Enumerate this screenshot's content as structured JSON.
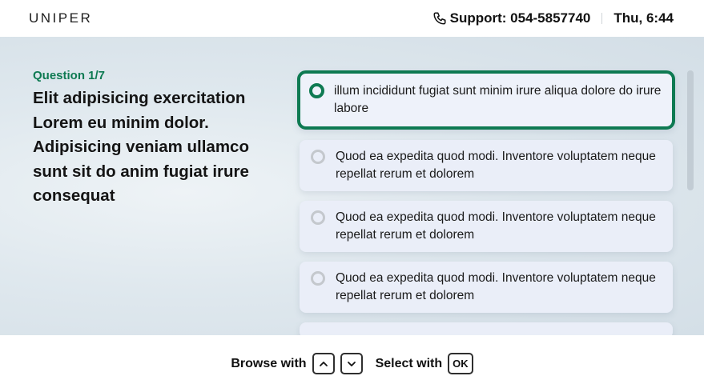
{
  "header": {
    "brand": "UNIPER",
    "support": "Support: 054-5857740",
    "datetime": "Thu, 6:44"
  },
  "question": {
    "number": "Question 1/7",
    "text": "Elit adipisicing exercitation Lorem eu minim dolor. Adipisicing veniam ullamco sunt sit do anim fugiat irure consequat"
  },
  "answers": [
    {
      "text": "illum incididunt fugiat sunt minim irure aliqua dolore do irure labore",
      "selected": true
    },
    {
      "text": "Quod ea expedita quod modi. Inventore voluptatem neque repellat rerum et dolorem",
      "selected": false
    },
    {
      "text": "Quod ea expedita quod modi. Inventore voluptatem neque repellat rerum et dolorem",
      "selected": false
    },
    {
      "text": "Quod ea expedita quod modi. Inventore voluptatem neque repellat rerum et dolorem",
      "selected": false
    }
  ],
  "footer": {
    "browse_label": "Browse with",
    "select_label": "Select with",
    "ok_key": "OK"
  },
  "icons": {
    "phone": "phone-icon",
    "up": "chevron-up-icon",
    "down": "chevron-down-icon"
  },
  "colors": {
    "accent": "#0e7a52",
    "answer_bg": "#eaeef8"
  }
}
